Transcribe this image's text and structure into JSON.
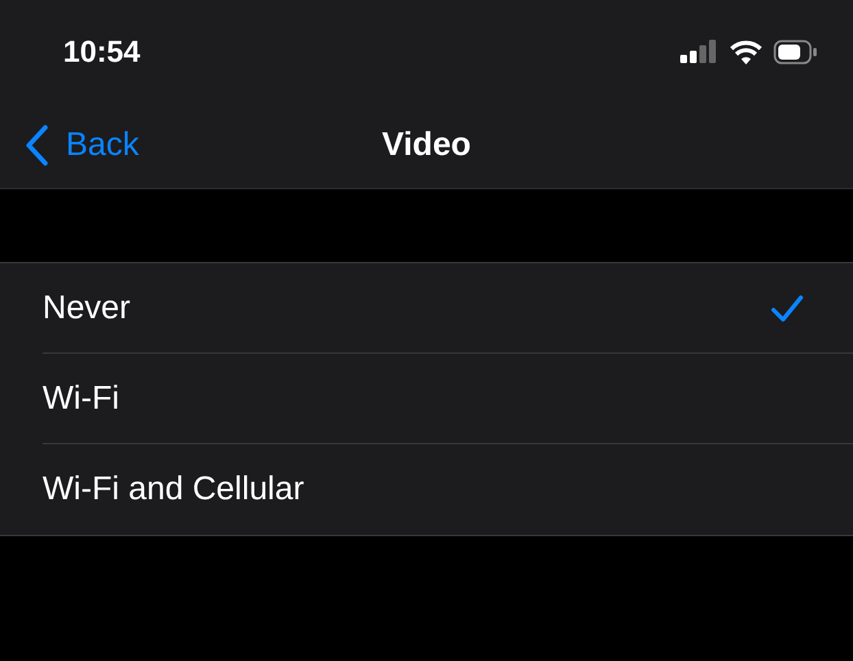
{
  "status_bar": {
    "time": "10:54"
  },
  "nav_bar": {
    "back": "Back",
    "title": "Video"
  },
  "options": [
    {
      "label": "Never",
      "selected": true
    },
    {
      "label": "Wi-Fi",
      "selected": false
    },
    {
      "label": "Wi-Fi and Cellular",
      "selected": false
    }
  ]
}
